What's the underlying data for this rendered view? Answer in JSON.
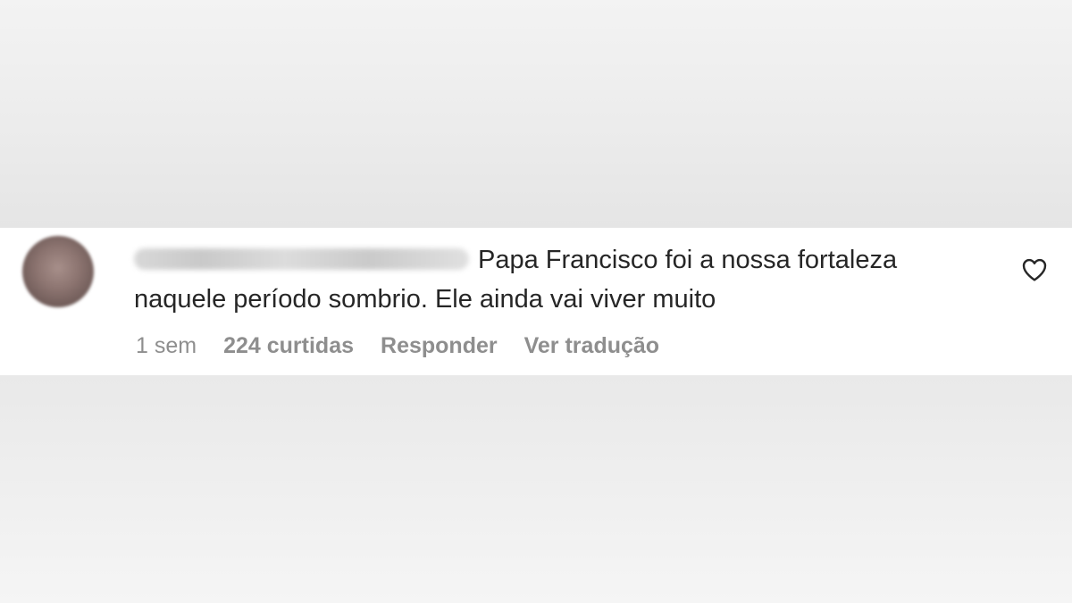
{
  "comment": {
    "text": "Papa Francisco foi a nossa fortaleza naquele período sombrio. Ele ainda vai viver muito",
    "time": "1 sem",
    "likes": "224 curtidas",
    "reply_label": "Responder",
    "translate_label": "Ver tradução",
    "like_icon": "heart-outline-icon"
  }
}
